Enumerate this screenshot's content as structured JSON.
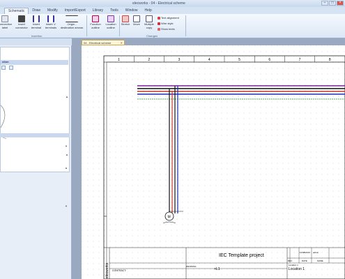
{
  "window": {
    "title": "elecworks - 04 - Electrical scheme"
  },
  "tabs": [
    "Schematic",
    "Draw",
    "Modify",
    "Import/Export",
    "Library",
    "Tools",
    "Window",
    "Help"
  ],
  "active_tab": "Schematic",
  "ribbon": {
    "insertion": {
      "label": "Insertion",
      "connection_label": "Connection\nlabel",
      "insert_connector": "Insert\nconnector",
      "insert_terminal": "Insert\nterminal",
      "insert_v_terminals": "Insert 'v'\nterminals",
      "origin_destination": "Origin -\ndestination arrows"
    },
    "function_outline": "Function\noutline",
    "location_outline": "Location\noutline",
    "changes": {
      "label": "Changes",
      "stretch": "Stretch",
      "move": "Move",
      "multiple_copy": "Multiple\ncopy",
      "text_alignment": "Text alignment",
      "wire_style": "Wire style",
      "show_texts": "Show texts"
    }
  },
  "left_panel": {
    "section_title": "ction"
  },
  "document": {
    "tab_label": "04 - Electrical scheme",
    "column_numbers": [
      "1",
      "2",
      "3",
      "4",
      "5",
      "6",
      "7",
      "8"
    ],
    "title_block": {
      "project_title": "IEC Template project",
      "location": "Location 1",
      "function": "+L1",
      "contract_label": "CONTRACT:",
      "drawing_label": "DRAWING:",
      "brand": "elecworks",
      "date": "11/08/2010",
      "author": "admin",
      "rev_label": "REV.",
      "date_label": "DATE",
      "name_label": "NAME",
      "small_note": "Location 1"
    },
    "motor_label": "M"
  },
  "colors": {
    "wire_black": "#111111",
    "wire_red": "#c0392b",
    "wire_blue": "#1f2fb8",
    "wire_purple": "#7a1fa6",
    "wire_pe": "#4caf50"
  }
}
